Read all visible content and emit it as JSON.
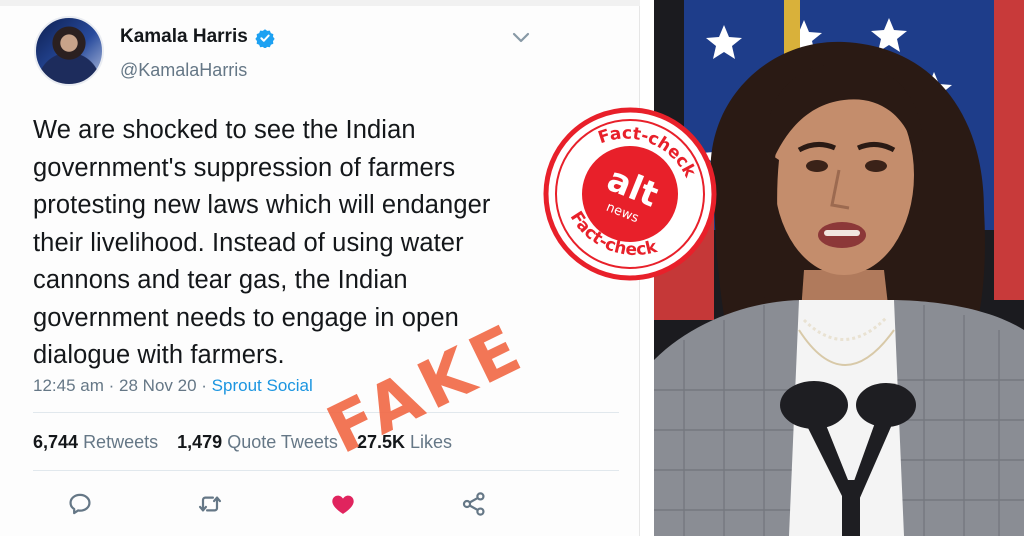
{
  "tweet": {
    "author_name": "Kamala Harris",
    "handle": "@KamalaHarris",
    "text": "We are shocked to see the Indian government's suppression of farmers protesting new laws which will endanger their livelihood. Instead of using water cannons and tear gas, the Indian government needs to engage in open dialogue with farmers.",
    "time": "12:45 am",
    "date": "28 Nov 20",
    "separator": "·",
    "source": "Sprout Social",
    "stats": {
      "retweets_count": "6,744",
      "retweets_label": "Retweets",
      "quotes_count": "1,479",
      "quotes_label": "Quote Tweets",
      "likes_count": "27.5K",
      "likes_label": "Likes"
    },
    "actions": [
      "reply-icon",
      "retweet-icon",
      "like-icon",
      "share-icon"
    ],
    "colors": {
      "verified": "#1da1f2",
      "link": "#1b95e0",
      "like": "#e0245e",
      "text": "#14171a",
      "muted": "#657786"
    }
  },
  "overlay": {
    "stamp_text": "FAKE",
    "stamp_color": "#f26c4a",
    "seal": {
      "top_text": "Fact-check",
      "bottom_text": "Fact-check",
      "logo_word": "alt",
      "logo_sub": "news",
      "color": "#e8202a"
    }
  }
}
